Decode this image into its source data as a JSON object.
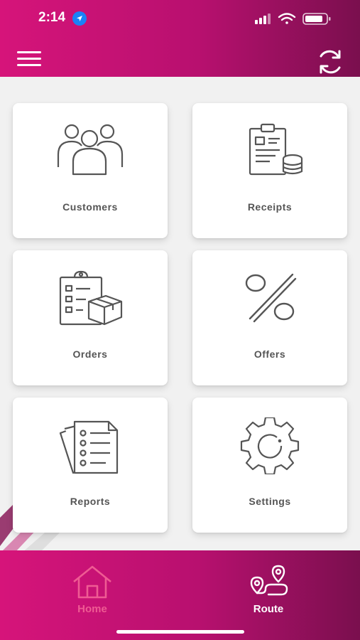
{
  "status_bar": {
    "time": "2:14"
  },
  "header": {
    "menu_icon": "hamburger-menu-icon",
    "refresh_icon": "refresh-icon"
  },
  "tiles": [
    {
      "label": "Customers",
      "icon": "customers-group-icon"
    },
    {
      "label": "Receipts",
      "icon": "receipts-clipboard-coins-icon"
    },
    {
      "label": "Orders",
      "icon": "orders-checklist-box-icon"
    },
    {
      "label": "Offers",
      "icon": "percent-icon"
    },
    {
      "label": "Reports",
      "icon": "reports-documents-icon"
    },
    {
      "label": "Settings",
      "icon": "gear-icon"
    }
  ],
  "bottom_nav": {
    "items": [
      {
        "label": "Home",
        "icon": "home-icon",
        "active": false
      },
      {
        "label": "Route",
        "icon": "route-icon",
        "active": true
      }
    ]
  },
  "colors": {
    "brand_primary": "#d6147a",
    "brand_dark": "#7a0f4e",
    "inactive_nav": "#ef5b93",
    "icon_gray": "#555555"
  }
}
